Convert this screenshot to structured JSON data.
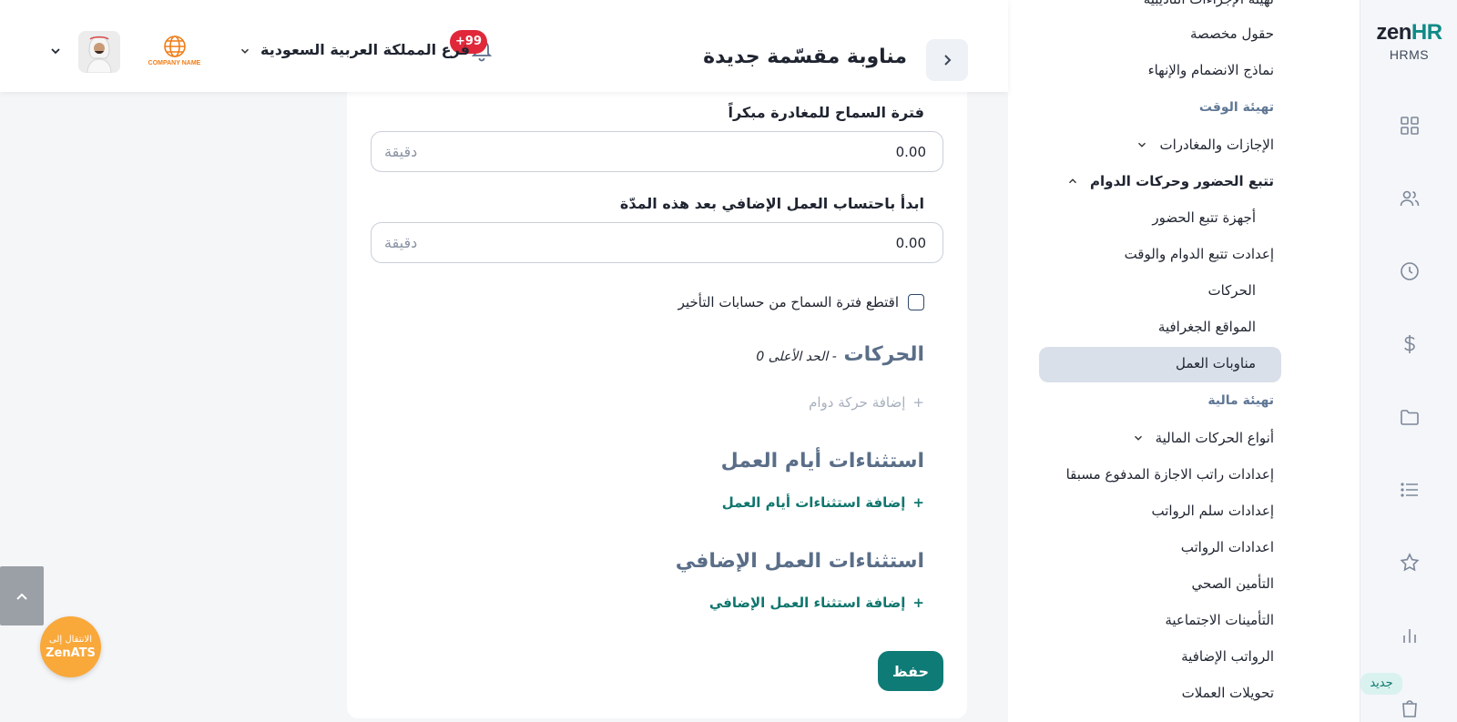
{
  "brand": {
    "logo_main": "zen",
    "logo_accent": "HR",
    "logo_sub": "HRMS",
    "accent_color": "#0f7b76"
  },
  "header": {
    "title": "مناوبة مقسّمة جديدة",
    "notifications_badge": "+99",
    "branch": "فرع المملكة العربية السعودية",
    "company_name": "COMPANY NAME"
  },
  "rail": {
    "icons": [
      "dashboard-icon",
      "users-icon",
      "clock-icon",
      "dollar-icon",
      "folder-icon",
      "list-icon",
      "star-icon",
      "chart-icon",
      "bag-icon"
    ],
    "new_badge": "جديد"
  },
  "nav": {
    "partial_top": "تهيئة الإجراءات التأديبية",
    "items": [
      {
        "label": "حقول مخصصة"
      },
      {
        "label": "نماذج الانضمام والإنهاء"
      }
    ],
    "section_time": "تهيئة الوقت",
    "leaves": "الإجازات والمغادرات",
    "attendance": "تتبع الحضور وحركات الدوام",
    "attendance_children": [
      {
        "label": "أجهزة تتبع الحضور"
      },
      {
        "label": "إعدادت تتبع الدوام والوقت"
      },
      {
        "label": "الحركات"
      },
      {
        "label": "المواقع الجغرافية"
      },
      {
        "label": "مناوبات العمل"
      }
    ],
    "section_finance": "تهيئة مالية",
    "finance_group": "أنواع الحركات المالية",
    "finance_items": [
      {
        "label": "إعدادات راتب الاجازة المدفوع مسبقا"
      },
      {
        "label": "إعدادات سلم الرواتب"
      },
      {
        "label": "اعدادات الرواتب"
      },
      {
        "label": "التأمين الصحي"
      },
      {
        "label": "التأمينات الاجتماعية"
      },
      {
        "label": "الرواتب الإضافية"
      },
      {
        "label": "تحويلات العملات"
      }
    ]
  },
  "form": {
    "early_leave_label": "فترة السماح للمغادرة مبكراً",
    "early_leave_value": "0.00",
    "early_leave_unit": "دقيقة",
    "overtime_label": "ابدأ باحتساب العمل الإضافي بعد هذه المدّة",
    "overtime_value": "0.00",
    "overtime_unit": "دقيقة",
    "deduct_checkbox_label": "اقتطع فترة السماح من حسابات التأخير",
    "deduct_checked": false,
    "movements_title": "الحركات",
    "movements_sub": "- الحد الأعلى 0",
    "add_movement": "إضافة حركة دوام",
    "workday_ex_title": "استثناءات أيام العمل",
    "add_workday_ex": "إضافة استثناءات أيام العمل",
    "overtime_ex_title": "استثناءات العمل الإضافي",
    "add_overtime_ex": "إضافة استثناء العمل الإضافي",
    "plus": "+",
    "save": "حفظ"
  },
  "floating": {
    "ats_line1": "الانتقال إلى",
    "ats_line2": "ZenATS"
  }
}
